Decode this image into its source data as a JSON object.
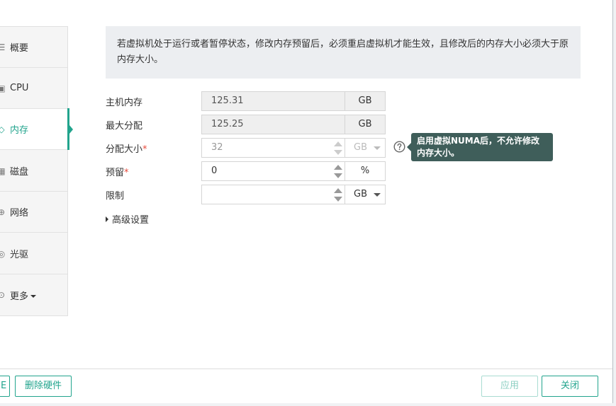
{
  "nav": {
    "items": [
      {
        "label": "概要",
        "icon": "list-icon"
      },
      {
        "label": "CPU",
        "icon": "cpu-icon"
      },
      {
        "label": "内存",
        "icon": "memory-icon",
        "active": true
      },
      {
        "label": "磁盘",
        "icon": "disk-icon"
      },
      {
        "label": "网络",
        "icon": "network-icon"
      },
      {
        "label": "光驱",
        "icon": "cdrom-icon"
      },
      {
        "label": "更多",
        "icon": "more-icon"
      }
    ]
  },
  "notice": {
    "text": "若虚拟机处于运行或者暂停状态，修改内存预留后，必须重启虚拟机才能生效，且修改后的内存大小必须大于原内存大小。"
  },
  "form": {
    "host_memory": {
      "label": "主机内存",
      "value": "125.31",
      "unit": "GB"
    },
    "max_alloc": {
      "label": "最大分配",
      "value": "125.25",
      "unit": "GB"
    },
    "alloc_size": {
      "label": "分配大小",
      "required_mark": "*",
      "value": "32",
      "unit": "GB"
    },
    "reserve": {
      "label": "预留",
      "required_mark": "*",
      "value": "0",
      "unit": "%"
    },
    "limit": {
      "label": "限制",
      "value": "",
      "unit": "GB"
    },
    "advanced_label": "高级设置"
  },
  "tooltip": {
    "text": "启用虚拟NUMA后，不允许修改内存大小。"
  },
  "footer": {
    "left_partial": "E",
    "delete_hw": "删除硬件",
    "apply": "应用",
    "close": "关闭"
  },
  "colors": {
    "accent": "#22a48d",
    "tooltip_bg": "#3f5e5a",
    "required": "#e84c3d"
  }
}
